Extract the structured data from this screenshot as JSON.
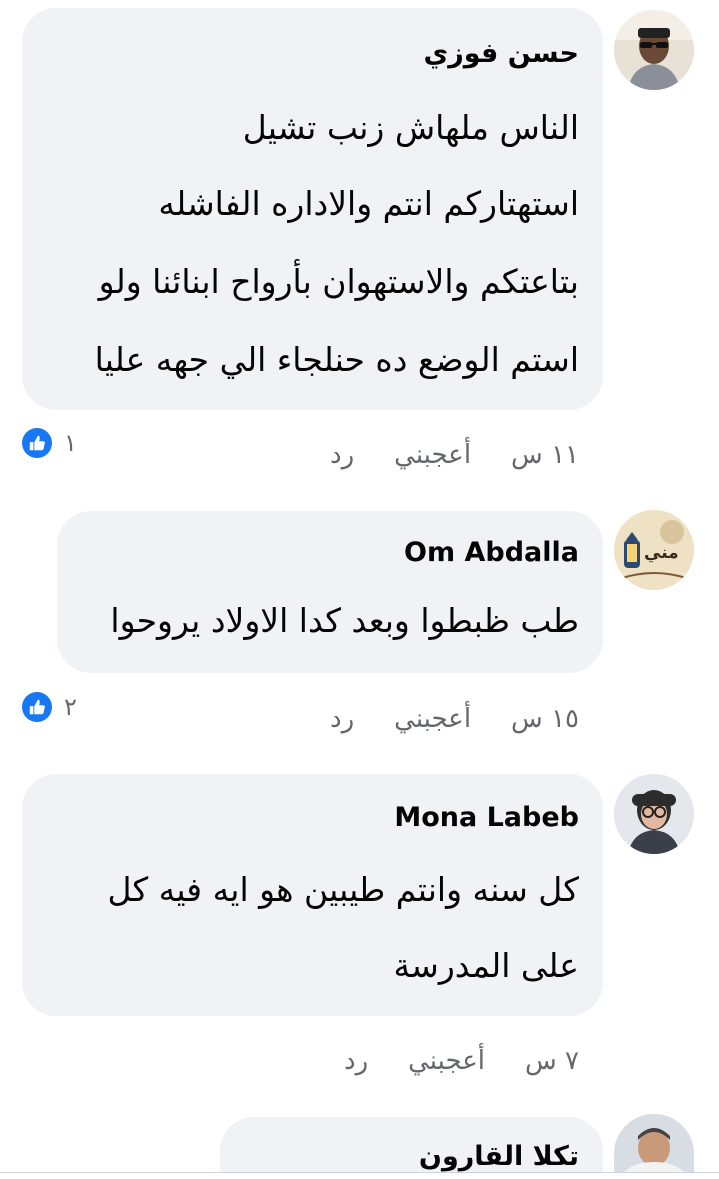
{
  "comments": [
    {
      "author": "حسن فوزي",
      "lines": [
        "الناس ملهاش زنب تشيل",
        "استهتاركم انتم والاداره الفاشله",
        "بتاعتكم والاستهوان بأرواح ابنائنا ولو",
        "استم الوضع ده حنلجاء الي جهه عليا"
      ],
      "time": "١١ س",
      "like_label": "أعجبني",
      "reply_label": "رد",
      "reaction_count": "١",
      "avatar_icon": "man-with-sunglasses-avatar"
    },
    {
      "author": "Om Abdalla",
      "lines": [
        "طب ظبطوا وبعد كدا الاولاد يروحوا"
      ],
      "time": "١٥ س",
      "like_label": "أعجبني",
      "reply_label": "رد",
      "reaction_count": "٢",
      "avatar_icon": "lantern-illustration-avatar",
      "avatar_text": "مني"
    },
    {
      "author": "Mona Labeb",
      "lines": [
        "كل سنه وانتم طيبين هو ايه فيه كل",
        "على المدرسة"
      ],
      "time": "٧ س",
      "like_label": "أعجبني",
      "reply_label": "رد",
      "avatar_icon": "woman-with-glasses-avatar"
    },
    {
      "author": "تكلا القارون",
      "avatar_icon": "man-portrait-avatar"
    }
  ],
  "colors": {
    "bubble": "#f0f2f5",
    "meta_text": "#65676b",
    "like_blue": "#1877f2"
  },
  "icons": {
    "reaction": "thumbs-up-icon"
  }
}
